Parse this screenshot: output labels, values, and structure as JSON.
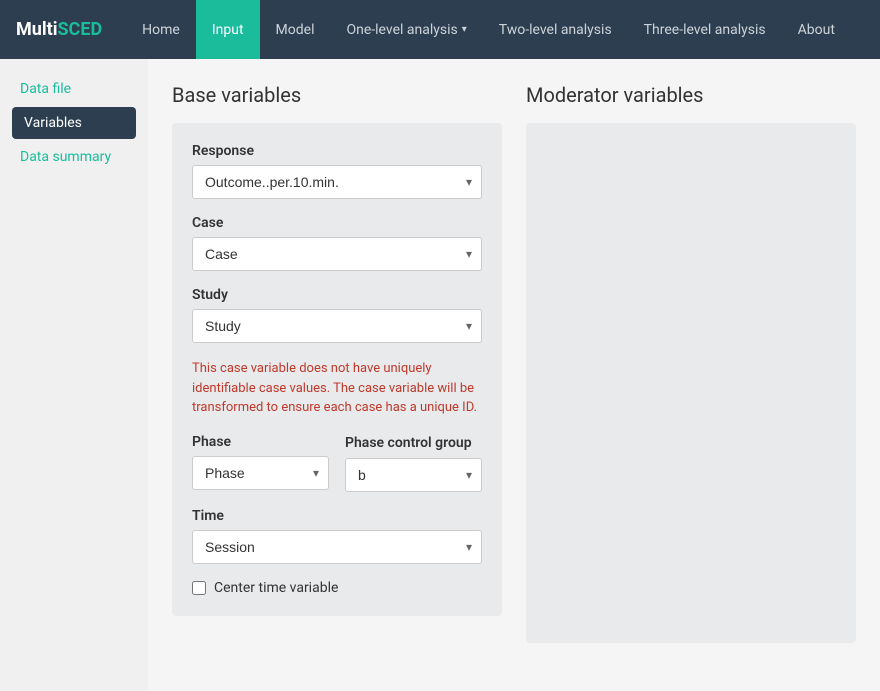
{
  "brand": {
    "name_part1": "Multi",
    "name_part2": "SCED"
  },
  "navbar": {
    "items": [
      {
        "label": "Home",
        "active": false
      },
      {
        "label": "Input",
        "active": true
      },
      {
        "label": "Model",
        "active": false
      },
      {
        "label": "One-level analysis",
        "active": false,
        "dropdown": true
      },
      {
        "label": "Two-level analysis",
        "active": false
      },
      {
        "label": "Three-level analysis",
        "active": false
      },
      {
        "label": "About",
        "active": false
      }
    ]
  },
  "sidebar": {
    "data_file_label": "Data file",
    "variables_label": "Variables",
    "data_summary_label": "Data summary"
  },
  "base_variables": {
    "title": "Base variables",
    "response": {
      "label": "Response",
      "selected": "Outcome..per.10.min.",
      "options": [
        "Outcome..per.10.min."
      ]
    },
    "case": {
      "label": "Case",
      "selected": "Case",
      "options": [
        "Case"
      ]
    },
    "study": {
      "label": "Study",
      "selected": "Study",
      "options": [
        "Study"
      ]
    },
    "warning": "This case variable does not have uniquely identifiable case values. The case variable will be transformed to ensure each case has a unique ID.",
    "phase": {
      "label": "Phase",
      "selected": "Phase",
      "options": [
        "Phase"
      ]
    },
    "phase_control_group": {
      "label": "Phase control group",
      "selected": "b",
      "options": [
        "b"
      ]
    },
    "time": {
      "label": "Time",
      "selected": "Session",
      "options": [
        "Session"
      ]
    },
    "center_time": {
      "label": "Center time variable",
      "checked": false
    }
  },
  "moderator_variables": {
    "title": "Moderator variables"
  }
}
